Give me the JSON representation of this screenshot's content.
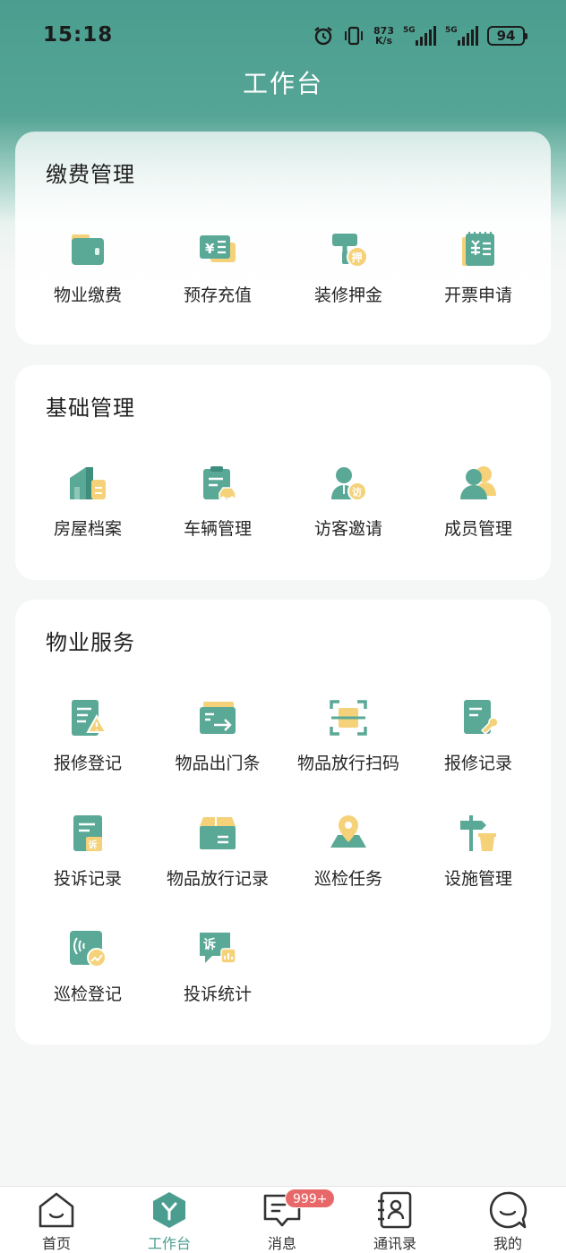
{
  "status_bar": {
    "time": "15:18",
    "net_speed_value": "873",
    "net_speed_unit": "K/s",
    "signal_1": "5G",
    "signal_2": "5G",
    "battery": "94"
  },
  "header": {
    "title": "工作台"
  },
  "sections": [
    {
      "title": "缴费管理",
      "items": [
        {
          "label": "物业缴费",
          "icon": "wallet-icon"
        },
        {
          "label": "预存充值",
          "icon": "prepaid-card-icon"
        },
        {
          "label": "装修押金",
          "icon": "paint-roller-deposit-icon"
        },
        {
          "label": "开票申请",
          "icon": "invoice-icon"
        }
      ]
    },
    {
      "title": "基础管理",
      "items": [
        {
          "label": "房屋档案",
          "icon": "house-file-icon"
        },
        {
          "label": "车辆管理",
          "icon": "vehicle-clipboard-icon"
        },
        {
          "label": "访客邀请",
          "icon": "visitor-icon"
        },
        {
          "label": "成员管理",
          "icon": "members-icon"
        }
      ]
    },
    {
      "title": "物业服务",
      "items": [
        {
          "label": "报修登记",
          "icon": "repair-register-icon"
        },
        {
          "label": "物品出门条",
          "icon": "item-exit-pass-icon"
        },
        {
          "label": "物品放行扫码",
          "icon": "scan-icon"
        },
        {
          "label": "报修记录",
          "icon": "repair-record-icon"
        },
        {
          "label": "投诉记录",
          "icon": "complaint-record-icon"
        },
        {
          "label": "物品放行记录",
          "icon": "release-record-box-icon"
        },
        {
          "label": "巡检任务",
          "icon": "patrol-task-map-icon"
        },
        {
          "label": "设施管理",
          "icon": "facility-signpost-icon"
        },
        {
          "label": "巡检登记",
          "icon": "patrol-register-icon"
        },
        {
          "label": "投诉统计",
          "icon": "complaint-stats-icon"
        }
      ]
    }
  ],
  "section_badges": {
    "complaint": "诉",
    "deposit": "押",
    "visitor": "访",
    "yen": "¥"
  },
  "tabbar": {
    "tabs": [
      {
        "label": "首页",
        "icon": "home-icon"
      },
      {
        "label": "工作台",
        "icon": "workbench-icon",
        "active": true
      },
      {
        "label": "消息",
        "icon": "message-icon",
        "badge": "999+"
      },
      {
        "label": "通讯录",
        "icon": "contacts-icon"
      },
      {
        "label": "我的",
        "icon": "profile-icon"
      }
    ]
  },
  "colors": {
    "primary": "#4b9e8f",
    "icon_green": "#5aa896",
    "icon_yellow": "#f5d27a",
    "badge": "#e8686a"
  }
}
